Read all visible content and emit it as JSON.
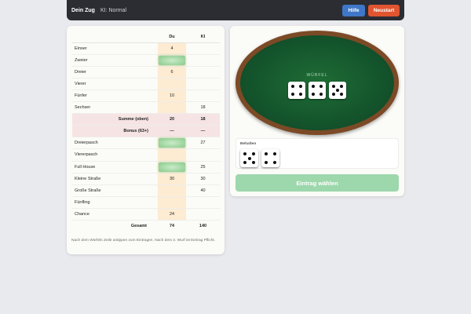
{
  "topbar": {
    "turn_label": "Dein Zug",
    "ai_level": "KI: Normal",
    "help_button": "Hilfe",
    "restart_button": "Neustart"
  },
  "scoreboard": {
    "col_you": "Du",
    "col_ai": "KI",
    "rows": [
      {
        "label": "Einser",
        "you": "4",
        "ai": "",
        "you_pick": false
      },
      {
        "label": "Zweier",
        "you": "",
        "ai": "",
        "you_pick": true
      },
      {
        "label": "Dreier",
        "you": "6",
        "ai": "",
        "you_pick": false
      },
      {
        "label": "Vierer",
        "you": "",
        "ai": "",
        "you_pick": false
      },
      {
        "label": "Fünfer",
        "you": "10",
        "ai": "",
        "you_pick": false
      },
      {
        "label": "Sechser",
        "you": "",
        "ai": "18",
        "you_pick": false
      },
      {
        "label": "Summe (oben)",
        "you": "20",
        "ai": "18",
        "you_pick": false
      },
      {
        "label": "Bonus (63+)",
        "you": "—",
        "ai": "—",
        "you_pick": false
      },
      {
        "label": "Dreierpasch",
        "you": "",
        "ai": "27",
        "you_pick": true
      },
      {
        "label": "Viererpasch",
        "you": "",
        "ai": "",
        "you_pick": false
      },
      {
        "label": "Full House",
        "you": "",
        "ai": "25",
        "you_pick": true
      },
      {
        "label": "Kleine Straße",
        "you": "30",
        "ai": "30",
        "you_pick": false
      },
      {
        "label": "Große Straße",
        "you": "",
        "ai": "40",
        "you_pick": false
      },
      {
        "label": "Fünfling",
        "you": "",
        "ai": "",
        "you_pick": false
      },
      {
        "label": "Chance",
        "you": "24",
        "ai": "",
        "you_pick": false
      }
    ],
    "total_label": "Gesamt",
    "total_you": "74",
    "total_ai": "140",
    "hint": "Nach dem Würfeln Zeile antippen zum Eintragen. Nach dem 3. Wurf ist Eintrag Pflicht."
  },
  "dice_area": {
    "label": "WÜRFEL",
    "dice": [
      4,
      4,
      5
    ]
  },
  "held": {
    "label": "Behalten",
    "dice": [
      5,
      4
    ]
  },
  "choose_button": "Eintrag wählen"
}
